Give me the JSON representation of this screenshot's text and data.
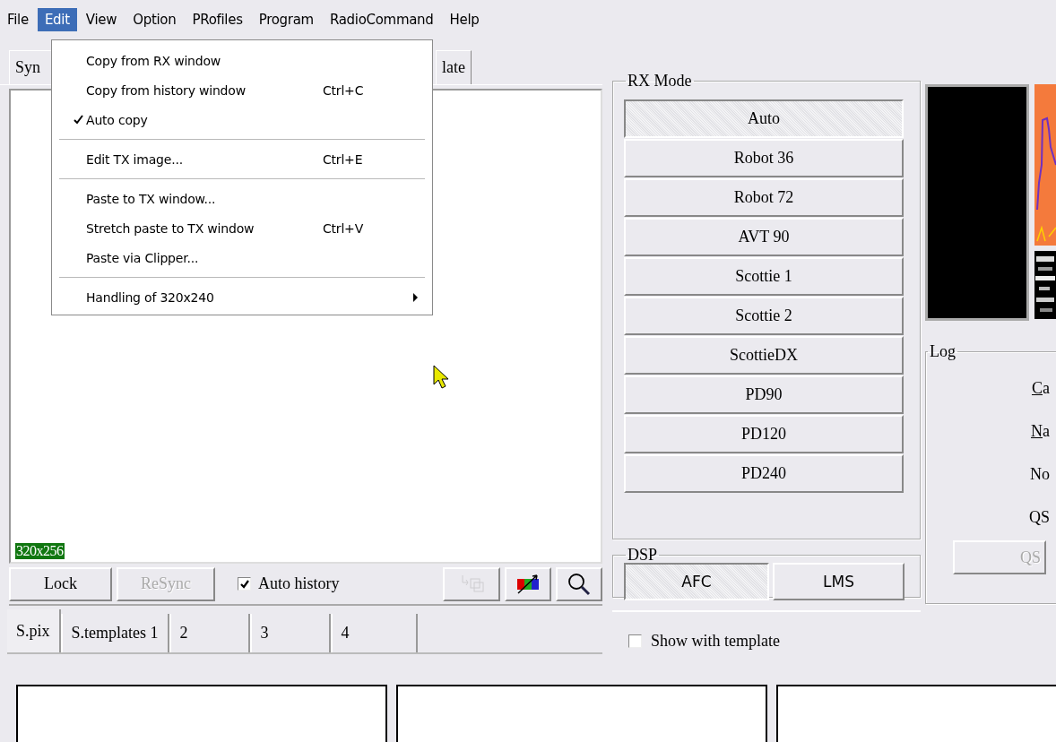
{
  "menubar": [
    {
      "label": "File",
      "selected": false
    },
    {
      "label": "Edit",
      "selected": true
    },
    {
      "label": "View",
      "selected": false
    },
    {
      "label": "Option",
      "selected": false
    },
    {
      "label": "PRofiles",
      "selected": false
    },
    {
      "label": "Program",
      "selected": false
    },
    {
      "label": "RadioCommand",
      "selected": false
    },
    {
      "label": "Help",
      "selected": false
    }
  ],
  "edit_menu": [
    {
      "kind": "item",
      "label": "Copy from RX window",
      "checked": false
    },
    {
      "kind": "item",
      "label": "Copy from history window",
      "shortcut": "Ctrl+C",
      "checked": false
    },
    {
      "kind": "item",
      "label": "Auto copy",
      "checked": true
    },
    {
      "kind": "separator"
    },
    {
      "kind": "item",
      "label": "Edit TX image...",
      "shortcut": "Ctrl+E",
      "checked": false
    },
    {
      "kind": "separator"
    },
    {
      "kind": "item",
      "label": "Paste to TX window...",
      "checked": false
    },
    {
      "kind": "item",
      "label": "Stretch paste to TX window",
      "shortcut": "Ctrl+V",
      "checked": false
    },
    {
      "kind": "item",
      "label": "Paste via Clipper...",
      "checked": false
    },
    {
      "kind": "separator"
    },
    {
      "kind": "submenu",
      "label": "Handling of 320x240",
      "checked": false
    }
  ],
  "top_tabs": [
    {
      "label": "Syn"
    },
    {
      "label": "late"
    }
  ],
  "rx_image": {
    "size_label": "320x256"
  },
  "rx_toolbar": {
    "buttons": [
      {
        "label": "Lock",
        "disabled": false
      },
      {
        "label": "ReSync",
        "disabled": true
      }
    ],
    "auto_history": {
      "label": "Auto history",
      "checked": true
    },
    "icon_buttons": [
      {
        "kind": "copy",
        "disabled": true
      },
      {
        "kind": "color",
        "disabled": false
      },
      {
        "kind": "zoom",
        "disabled": false
      }
    ]
  },
  "history_tabs": [
    {
      "label": "S.pix",
      "selected": true
    },
    {
      "label": "S.templates 1",
      "selected": false
    },
    {
      "label": "2",
      "selected": false
    },
    {
      "label": "3",
      "selected": false
    },
    {
      "label": "4",
      "selected": false
    }
  ],
  "rx_mode": {
    "title": "RX Mode",
    "modes": [
      {
        "label": "Auto",
        "selected": true
      },
      {
        "label": "Robot 36",
        "selected": false
      },
      {
        "label": "Robot 72",
        "selected": false
      },
      {
        "label": "AVT 90",
        "selected": false
      },
      {
        "label": "Scottie 1",
        "selected": false
      },
      {
        "label": "Scottie 2",
        "selected": false
      },
      {
        "label": "ScottieDX",
        "selected": false
      },
      {
        "label": "PD90",
        "selected": false
      },
      {
        "label": "PD120",
        "selected": false
      },
      {
        "label": "PD240",
        "selected": false
      }
    ]
  },
  "dsp": {
    "title": "DSP",
    "buttons": [
      {
        "label": "AFC",
        "on": true
      },
      {
        "label": "LMS",
        "on": false
      }
    ]
  },
  "show_with_template": {
    "label": "Show with template",
    "checked": false
  },
  "log": {
    "title": "Log",
    "fields": [
      {
        "label": "Ca",
        "underline_first": true
      },
      {
        "label": "Na",
        "underline_first": true
      },
      {
        "label": "No",
        "underline_first": false
      },
      {
        "label": "QS",
        "underline_first": false
      }
    ],
    "button": {
      "label": "QS",
      "disabled": true
    }
  }
}
